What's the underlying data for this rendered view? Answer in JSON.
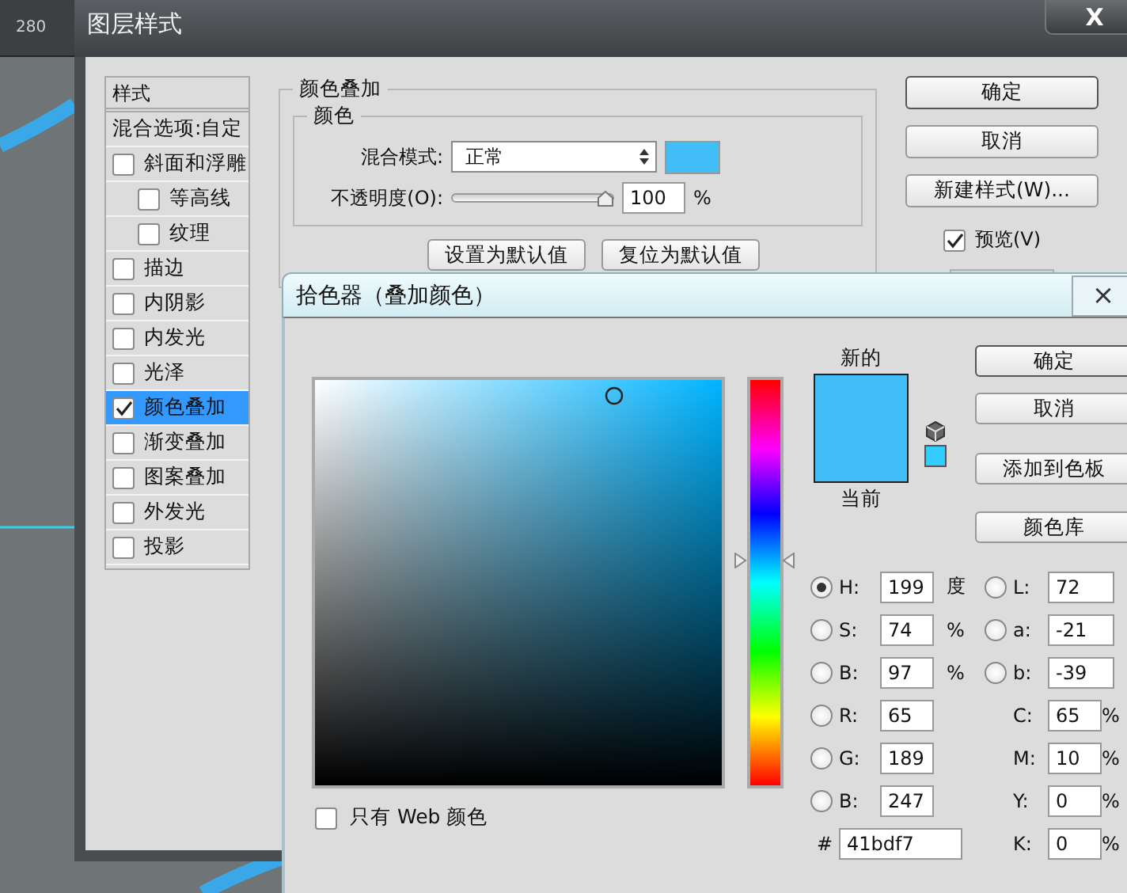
{
  "ruler": {
    "mark": "280"
  },
  "layer_style_dialog": {
    "title": "图层样式",
    "close": "X",
    "styles_header": "样式",
    "blending_options": "混合选项:自定",
    "styles": [
      {
        "label": "斜面和浮雕",
        "checked": false,
        "selected": false,
        "children": [
          {
            "label": "等高线",
            "checked": false
          },
          {
            "label": "纹理",
            "checked": false
          }
        ]
      },
      {
        "label": "描边",
        "checked": false,
        "selected": false
      },
      {
        "label": "内阴影",
        "checked": false,
        "selected": false
      },
      {
        "label": "内发光",
        "checked": false,
        "selected": false
      },
      {
        "label": "光泽",
        "checked": false,
        "selected": false
      },
      {
        "label": "颜色叠加",
        "checked": true,
        "selected": true
      },
      {
        "label": "渐变叠加",
        "checked": false,
        "selected": false
      },
      {
        "label": "图案叠加",
        "checked": false,
        "selected": false
      },
      {
        "label": "外发光",
        "checked": false,
        "selected": false
      },
      {
        "label": "投影",
        "checked": false,
        "selected": false
      }
    ],
    "color_overlay": {
      "title": "颜色叠加",
      "section_title": "颜色",
      "blend_mode_label": "混合模式:",
      "blend_mode": "正常",
      "color": "#41bdf7",
      "opacity_label": "不透明度(O):",
      "opacity": {
        "level": 1
      },
      "opacity_value": "100",
      "opacity_unit": "%",
      "buttons": [
        "设置为默认值",
        "复位为默认值"
      ]
    },
    "buttons": [
      "确定",
      "取消",
      "新建样式(W)..."
    ],
    "preview": {
      "label": "预览(V)",
      "checked": true
    }
  },
  "color_picker": {
    "title": "拾色器（叠加颜色）",
    "close": "×",
    "hue_slider": {
      "level": 0.553
    },
    "web_only": {
      "label": "只有 Web 颜色",
      "checked": false
    },
    "new_label": "新的",
    "current_label": "当前",
    "swatches": [
      {
        "color": "#41bdf7"
      },
      {
        "color": "#41bdf7"
      }
    ],
    "buttons": [
      "确定",
      "取消",
      "添加到色板",
      "颜色库"
    ],
    "hsb": [
      {
        "label": "H:",
        "value": "199",
        "unit": "度",
        "selected": true
      },
      {
        "label": "S:",
        "value": "74",
        "unit": "%",
        "selected": false
      },
      {
        "label": "B:",
        "value": "97",
        "unit": "%",
        "selected": false
      }
    ],
    "lab": [
      {
        "label": "L:",
        "value": "72",
        "selected": false
      },
      {
        "label": "a:",
        "value": "-21",
        "selected": false
      },
      {
        "label": "b:",
        "value": "-39",
        "selected": false
      }
    ],
    "rgb": [
      {
        "label": "R:",
        "value": "65",
        "selected": false
      },
      {
        "label": "G:",
        "value": "189",
        "selected": false
      },
      {
        "label": "B:",
        "value": "247",
        "selected": false
      }
    ],
    "cmyk": [
      {
        "label": "C:",
        "value": "65",
        "unit": "%"
      },
      {
        "label": "M:",
        "value": "10",
        "unit": "%"
      },
      {
        "label": "Y:",
        "value": "0",
        "unit": "%"
      },
      {
        "label": "K:",
        "value": "0",
        "unit": "%"
      }
    ],
    "hex": {
      "label": "#",
      "value": "41bdf7"
    }
  }
}
